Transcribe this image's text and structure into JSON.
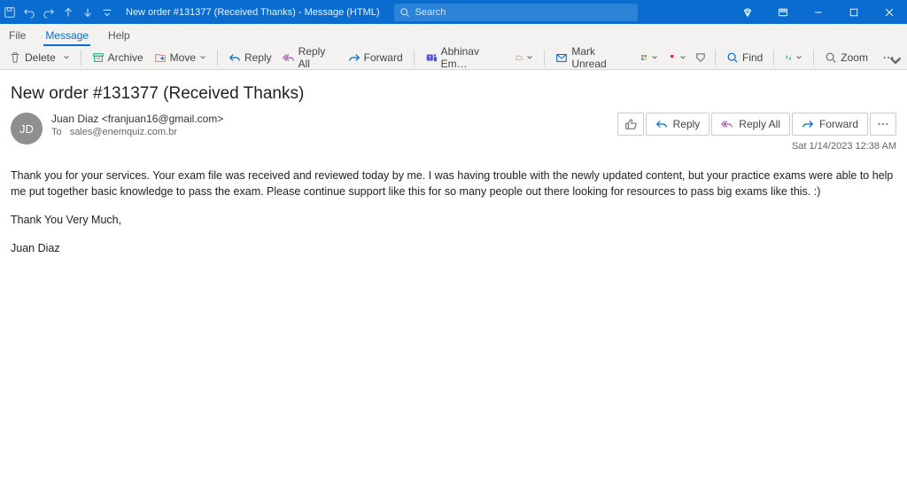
{
  "titlebar": {
    "title": "New order #131377 (Received Thanks)  -  Message (HTML)",
    "search_placeholder": "Search"
  },
  "tabs": {
    "file": "File",
    "message": "Message",
    "help": "Help"
  },
  "ribbon": {
    "delete": "Delete",
    "archive": "Archive",
    "move": "Move",
    "reply": "Reply",
    "reply_all": "Reply All",
    "forward": "Forward",
    "teams": "Abhinav Em…",
    "mark_unread": "Mark Unread",
    "find": "Find",
    "zoom": "Zoom"
  },
  "message": {
    "subject": "New order #131377 (Received Thanks)",
    "avatar_initials": "JD",
    "sender_line": "Juan Diaz <franjuan16@gmail.com>",
    "to_label": "To",
    "to_value": "sales@enemquiz.com.br",
    "date": "Sat 1/14/2023 12:38 AM",
    "body_p1": "Thank you for your services. Your exam file was received and reviewed today by me. I was having trouble with the newly updated content, but your practice exams were able to help me put together basic knowledge to pass the exam. Please continue support like this for so many people out there looking for resources to pass big exams like this. :)",
    "body_p2": "Thank You Very Much,",
    "body_p3": "Juan Diaz"
  },
  "actions": {
    "reply": "Reply",
    "reply_all": "Reply All",
    "forward": "Forward"
  }
}
